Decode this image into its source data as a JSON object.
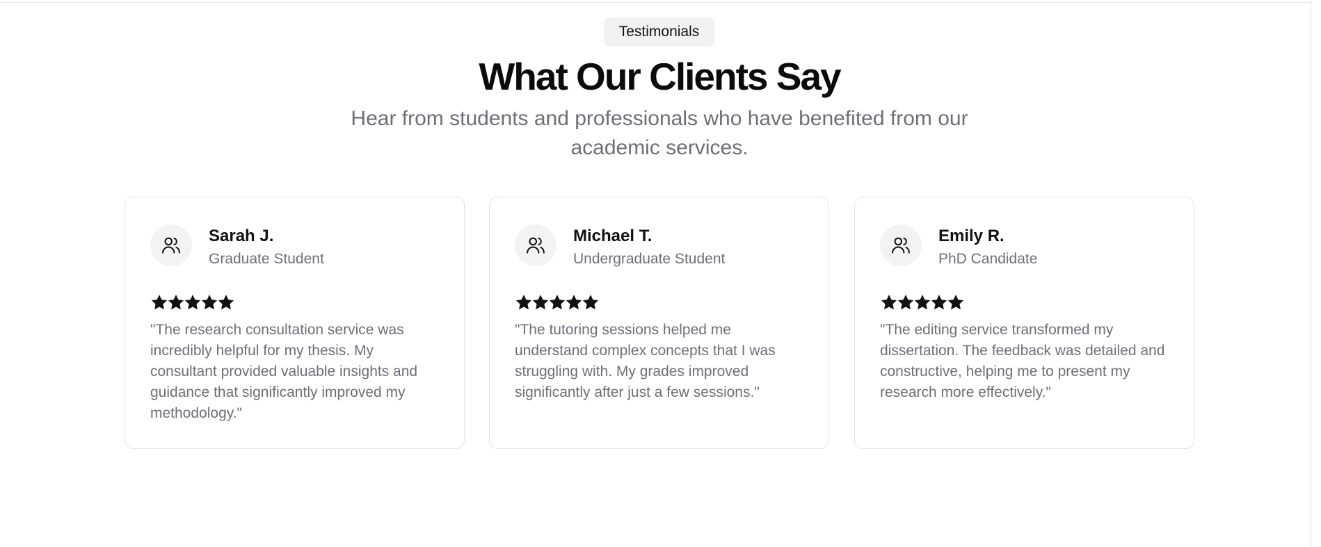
{
  "section": {
    "badge": "Testimonials",
    "heading": "What Our Clients Say",
    "subtitle": "Hear from students and professionals who have benefited from our academic services."
  },
  "testimonials": [
    {
      "name": "Sarah J.",
      "role": "Graduate Student",
      "rating": 5,
      "quote": "\"The research consultation service was incredibly helpful for my thesis. My consultant provided valuable insights and guidance that significantly improved my methodology.\""
    },
    {
      "name": "Michael T.",
      "role": "Undergraduate Student",
      "rating": 5,
      "quote": "\"The tutoring sessions helped me understand complex concepts that I was struggling with. My grades improved significantly after just a few sessions.\""
    },
    {
      "name": "Emily R.",
      "role": "PhD Candidate",
      "rating": 5,
      "quote": "\"The editing service transformed my dissertation. The feedback was detailed and constructive, helping me to present my research more effectively.\""
    }
  ],
  "icons": {
    "avatar": "users-icon",
    "rating": "star-icon"
  },
  "colors": {
    "heading": "#0b0b0b",
    "muted_text": "#6e6e78",
    "badge_bg": "#f2f2f2",
    "card_border": "#e4e4e7",
    "star": "#111111"
  }
}
